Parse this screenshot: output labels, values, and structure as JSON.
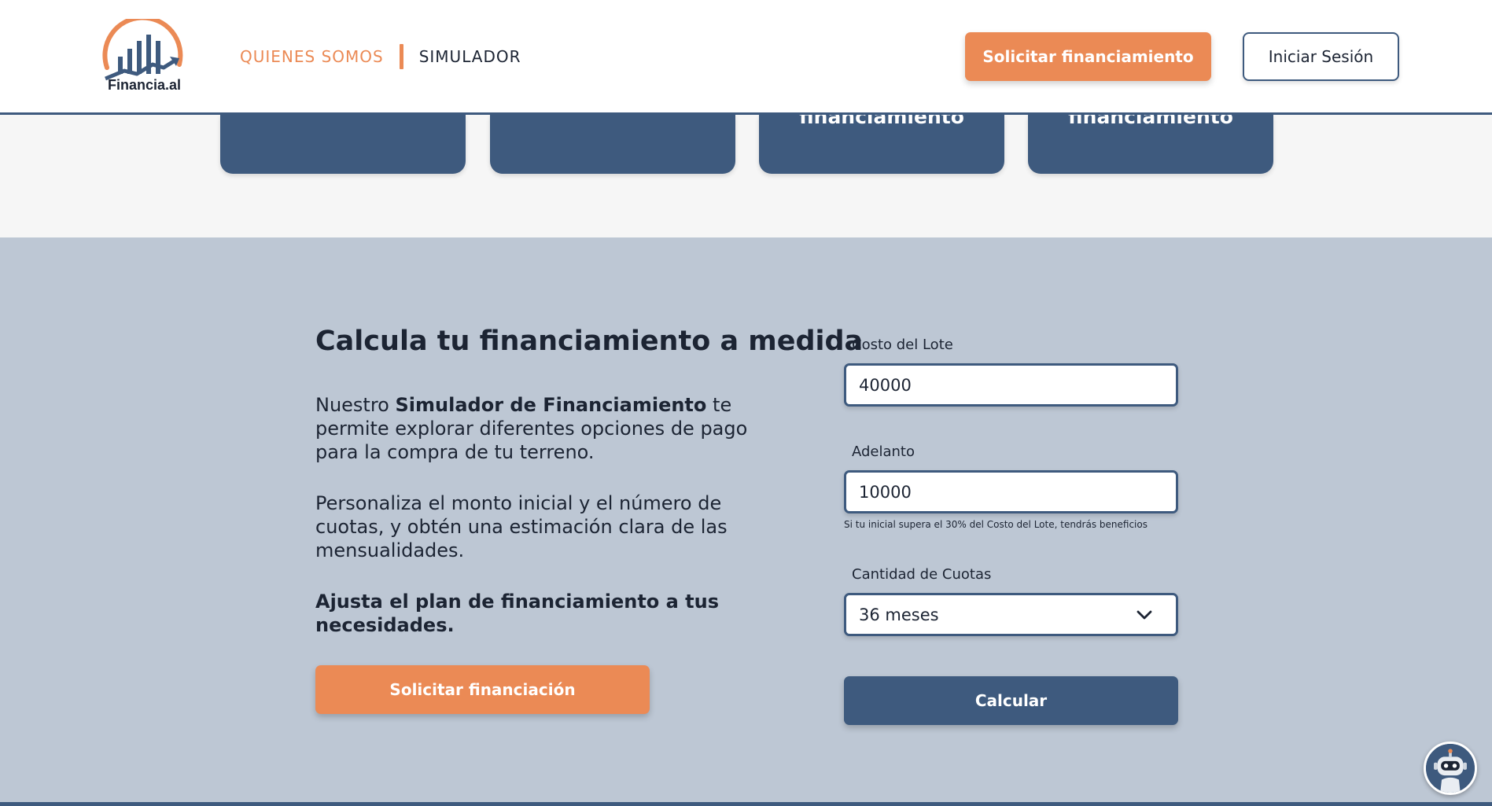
{
  "header": {
    "logo_text": "Financia.al",
    "nav": [
      {
        "label": "QUIENES SOMOS"
      },
      {
        "label": "SIMULADOR"
      }
    ],
    "cta_label": "Solicitar financiamiento",
    "login_label": "Iniciar Sesión"
  },
  "cards": [
    {
      "text": ""
    },
    {
      "text": ""
    },
    {
      "text": "financiamiento"
    },
    {
      "text": "financiamiento"
    }
  ],
  "simulator": {
    "title": "Calcula tu financiamiento a medida",
    "p1_prefix": "Nuestro ",
    "p1_bold": "Simulador de Financiamiento",
    "p1_suffix": " te permite explorar diferentes opciones de pago para la compra de tu terreno.",
    "p2": "Personaliza el monto inicial y el número de cuotas, y obtén una estimación clara de las mensualidades.",
    "p3": "Ajusta el plan de financiamiento a tus necesidades.",
    "solicitar_label": "Solicitar financiación",
    "form": {
      "costo_label": "Costo del Lote",
      "costo_value": "40000",
      "adelanto_label": "Adelanto",
      "adelanto_value": "10000",
      "hint": "Si tu inicial supera el 30% del Costo del Lote, tendrás beneficios",
      "cuotas_label": "Cantidad de Cuotas",
      "cuotas_value": "36 meses",
      "calcular_label": "Calcular"
    }
  },
  "colors": {
    "accent_orange": "#eb8a55",
    "navy": "#3e5a7e",
    "section_bg": "#bdc7d4"
  }
}
